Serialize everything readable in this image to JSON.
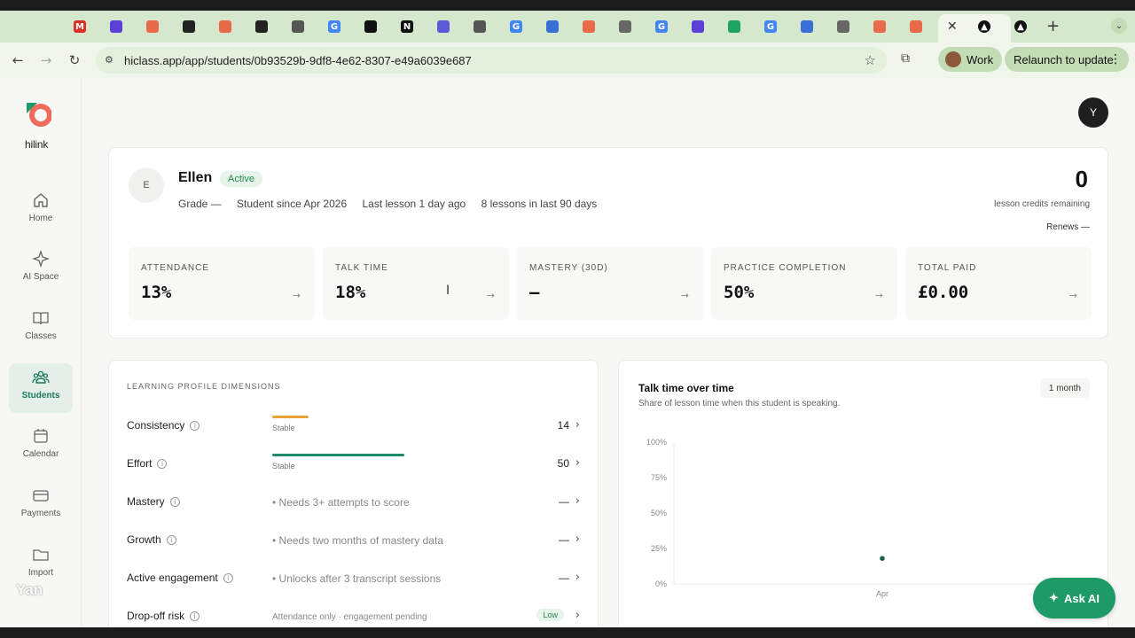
{
  "browser": {
    "tabs": [
      {
        "icon": "gmail-icon",
        "glyph": "M",
        "color": "#d93025"
      },
      {
        "icon": "app-icon",
        "glyph": "",
        "color": "#5b3fd6"
      },
      {
        "icon": "app-icon",
        "glyph": "",
        "color": "#e86a4a"
      },
      {
        "icon": "app-icon",
        "glyph": "",
        "color": "#222222"
      },
      {
        "icon": "app-icon",
        "glyph": "",
        "color": "#e86a4a"
      },
      {
        "icon": "github-icon",
        "glyph": "",
        "color": "#222222"
      },
      {
        "icon": "github-icon",
        "glyph": "",
        "color": "#555555"
      },
      {
        "icon": "google-icon",
        "glyph": "G",
        "color": "#4285f4"
      },
      {
        "icon": "app-icon",
        "glyph": "",
        "color": "#111111"
      },
      {
        "icon": "notion-icon",
        "glyph": "N",
        "color": "#111111"
      },
      {
        "icon": "app-icon",
        "glyph": "",
        "color": "#5b5bd6"
      },
      {
        "icon": "github-icon",
        "glyph": "",
        "color": "#555555"
      },
      {
        "icon": "google-icon",
        "glyph": "G",
        "color": "#4285f4"
      },
      {
        "icon": "docs-icon",
        "glyph": "",
        "color": "#3a6fd8"
      },
      {
        "icon": "app-icon",
        "glyph": "",
        "color": "#e86a4a"
      },
      {
        "icon": "app-icon",
        "glyph": "",
        "color": "#666666"
      },
      {
        "icon": "google-icon",
        "glyph": "G",
        "color": "#4285f4"
      },
      {
        "icon": "app-icon",
        "glyph": "",
        "color": "#5b3fd6"
      },
      {
        "icon": "drive-icon",
        "glyph": "",
        "color": "#1ea362"
      },
      {
        "icon": "google-icon",
        "glyph": "G",
        "color": "#4285f4"
      },
      {
        "icon": "app-icon",
        "glyph": "",
        "color": "#3a6fd8"
      },
      {
        "icon": "app-icon",
        "glyph": "",
        "color": "#666666"
      },
      {
        "icon": "app-icon",
        "glyph": "",
        "color": "#e86a4a"
      },
      {
        "icon": "app-icon",
        "glyph": "",
        "color": "#e86a4a"
      }
    ],
    "url": "hiclass.app/app/students/0b93529b-9df8-4e62-8307-e49a6039e687",
    "profile_label": "Work",
    "relaunch_label": "Relaunch to update"
  },
  "sidebar": {
    "logo_text": "hilink",
    "items": [
      {
        "label": "Home",
        "icon": "home-icon"
      },
      {
        "label": "AI Space",
        "icon": "sparkle-icon"
      },
      {
        "label": "Classes",
        "icon": "book-icon"
      },
      {
        "label": "Students",
        "icon": "students-icon"
      },
      {
        "label": "Calendar",
        "icon": "calendar-icon"
      },
      {
        "label": "Payments",
        "icon": "card-icon"
      },
      {
        "label": "Import",
        "icon": "folder-icon"
      }
    ],
    "active": "Students",
    "watermark": "Yan"
  },
  "user": {
    "initial": "Y"
  },
  "student": {
    "initial": "E",
    "name": "Ellen",
    "status": "Active",
    "grade": "Grade —",
    "since": "Student since Apr 2026",
    "last_lesson": "Last lesson 1 day ago",
    "lessons": "8 lessons in last 90 days",
    "credits": "0",
    "credits_label": "lesson credits remaining",
    "renews": "Renews —"
  },
  "metrics": [
    {
      "label": "ATTENDANCE",
      "value": "13%"
    },
    {
      "label": "TALK TIME",
      "value": "18%"
    },
    {
      "label": "MASTERY (30D)",
      "value": "—"
    },
    {
      "label": "PRACTICE COMPLETION",
      "value": "50%"
    },
    {
      "label": "TOTAL PAID",
      "value": "£0.00"
    }
  ],
  "profile": {
    "title": "LEARNING PROFILE DIMENSIONS",
    "rows": [
      {
        "name": "Consistency",
        "status": "Stable",
        "value": "14",
        "bar_fraction": 0.27,
        "bar_color": "#e8a23a"
      },
      {
        "name": "Effort",
        "status": "Stable",
        "value": "50",
        "bar_fraction": 0.99,
        "bar_color": "#1e8a6a"
      },
      {
        "name": "Mastery",
        "note": "• Needs 3+ attempts to score",
        "value": "—"
      },
      {
        "name": "Growth",
        "note": "• Needs two months of mastery data",
        "value": "—"
      },
      {
        "name": "Active engagement",
        "note": "• Unlocks after 3 transcript sessions",
        "value": "—"
      },
      {
        "name": "Drop-off risk",
        "note": "Attendance only · engagement pending",
        "badge": "Low"
      }
    ]
  },
  "talk_chart": {
    "title": "Talk time over time",
    "subtitle": "Share of lesson time when this student is speaking.",
    "range": "1 month"
  },
  "chart_data": {
    "type": "scatter",
    "title": "Talk time over time",
    "subtitle": "Share of lesson time when this student is speaking.",
    "x": [
      "Apr"
    ],
    "y": [
      18
    ],
    "y_tick_labels": [
      "0%",
      "25%",
      "50%",
      "75%",
      "100%"
    ],
    "ylim": [
      0,
      100
    ],
    "grid": false,
    "color": "#1e5e4a"
  },
  "ask_ai": "Ask AI"
}
